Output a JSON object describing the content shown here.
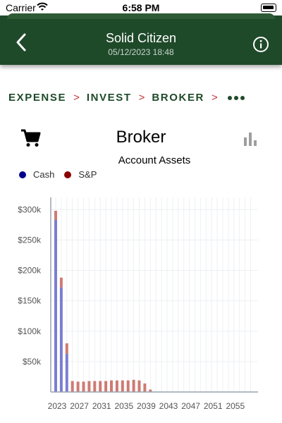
{
  "status_bar": {
    "carrier": "Carrier",
    "time": "6:58 PM"
  },
  "header": {
    "title": "Solid Citizen",
    "subtitle": "05/12/2023 18:48"
  },
  "breadcrumb": {
    "items": [
      "EXPENSE",
      "INVEST",
      "BROKER"
    ],
    "separator": ">"
  },
  "page": {
    "title": "Broker"
  },
  "colors": {
    "header_bg": "#1f4a2a",
    "cash": "#7b7ed0",
    "sp": "#cf7a73",
    "separator": "#c4323a"
  },
  "chart_data": {
    "type": "bar",
    "title": "Account Assets",
    "legend": [
      {
        "name": "Cash",
        "color": "#00008b"
      },
      {
        "name": "S&P",
        "color": "#8b0000"
      }
    ],
    "x": [
      2023,
      2024,
      2025,
      2026,
      2027,
      2028,
      2029,
      2030,
      2031,
      2032,
      2033,
      2034,
      2035,
      2036,
      2037,
      2038,
      2039,
      2040,
      2041,
      2042,
      2043,
      2044,
      2045,
      2046,
      2047,
      2048,
      2049,
      2050,
      2051,
      2052,
      2053,
      2054,
      2055,
      2056,
      2057,
      2058
    ],
    "series": [
      {
        "name": "Cash",
        "values": [
          283000,
          172000,
          63000,
          0,
          0,
          0,
          0,
          0,
          0,
          0,
          0,
          0,
          0,
          0,
          0,
          0,
          0,
          0,
          0,
          0,
          0,
          0,
          0,
          0,
          0,
          0,
          0,
          0,
          0,
          0,
          0,
          0,
          0,
          0,
          0,
          0
        ]
      },
      {
        "name": "S&P",
        "values": [
          15000,
          16000,
          17000,
          18000,
          17000,
          17000,
          18000,
          18000,
          18000,
          18000,
          19000,
          19000,
          19000,
          19000,
          20000,
          19000,
          14000,
          4000,
          0,
          0,
          0,
          0,
          0,
          0,
          0,
          0,
          0,
          0,
          0,
          0,
          0,
          0,
          0,
          0,
          0,
          0
        ]
      }
    ],
    "ylim": [
      0,
      320000
    ],
    "y_ticks": [
      50000,
      100000,
      150000,
      200000,
      250000,
      300000
    ],
    "y_tick_labels": [
      "$50k",
      "$100k",
      "$150k",
      "$200k",
      "$250k",
      "$300k"
    ],
    "x_tick_labels": [
      "2023",
      "2027",
      "2031",
      "2035",
      "2039",
      "2043",
      "2047",
      "2051",
      "2055"
    ],
    "grid": true
  }
}
